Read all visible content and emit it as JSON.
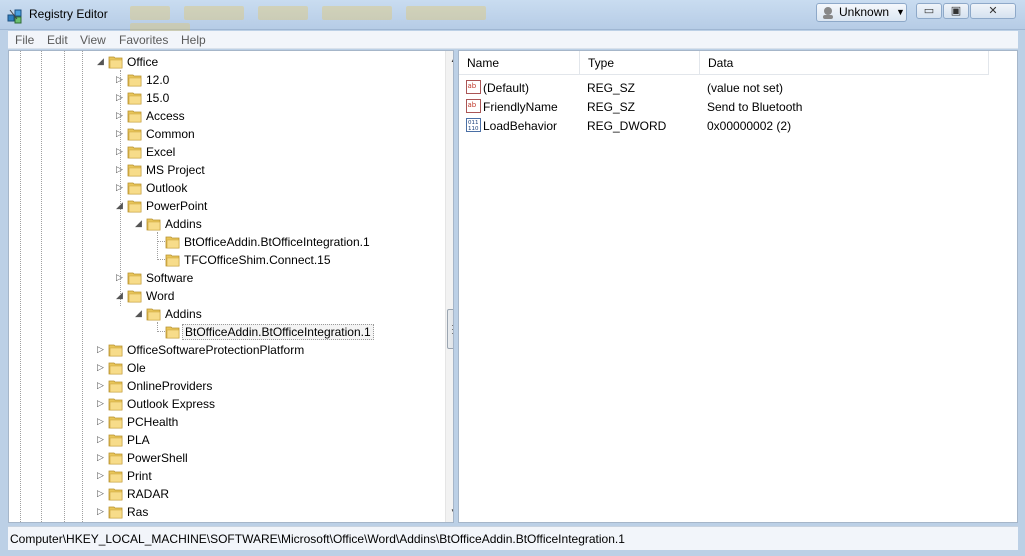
{
  "window": {
    "title": "Registry Editor",
    "account_label": "Unknown",
    "controls": {
      "minimize": "▭",
      "maximize": "▣",
      "close": "✕"
    }
  },
  "menu": {
    "items": [
      {
        "label": "File"
      },
      {
        "label": "Edit"
      },
      {
        "label": "View"
      },
      {
        "label": "Favorites"
      },
      {
        "label": "Help"
      }
    ]
  },
  "tree": {
    "nodes": [
      {
        "label": "Office",
        "expander": "◢",
        "expanded": true
      },
      {
        "label": "12.0",
        "expander": "▷"
      },
      {
        "label": "15.0",
        "expander": "▷"
      },
      {
        "label": "Access",
        "expander": "▷"
      },
      {
        "label": "Common",
        "expander": "▷"
      },
      {
        "label": "Excel",
        "expander": "▷"
      },
      {
        "label": "MS Project",
        "expander": "▷"
      },
      {
        "label": "Outlook",
        "expander": "▷"
      },
      {
        "label": "PowerPoint",
        "expander": "◢",
        "expanded": true
      },
      {
        "label": "Addins",
        "expander": "◢",
        "expanded": true
      },
      {
        "label": "BtOfficeAddin.BtOfficeIntegration.1",
        "expander": ""
      },
      {
        "label": "TFCOfficeShim.Connect.15",
        "expander": ""
      },
      {
        "label": "Software",
        "expander": "▷"
      },
      {
        "label": "Word",
        "expander": "◢",
        "expanded": true
      },
      {
        "label": "Addins",
        "expander": "◢",
        "expanded": true
      },
      {
        "label": "BtOfficeAddin.BtOfficeIntegration.1",
        "expander": "",
        "selected": true
      },
      {
        "label": "OfficeSoftwareProtectionPlatform",
        "expander": "▷"
      },
      {
        "label": "Ole",
        "expander": "▷"
      },
      {
        "label": "OnlineProviders",
        "expander": "▷"
      },
      {
        "label": "Outlook Express",
        "expander": "▷"
      },
      {
        "label": "PCHealth",
        "expander": "▷"
      },
      {
        "label": "PLA",
        "expander": "▷"
      },
      {
        "label": "PowerShell",
        "expander": "▷"
      },
      {
        "label": "Print",
        "expander": "▷"
      },
      {
        "label": "RADAR",
        "expander": "▷"
      },
      {
        "label": "Ras",
        "expander": "▷"
      }
    ]
  },
  "values_list": {
    "columns": [
      {
        "label": "Name"
      },
      {
        "label": "Type"
      },
      {
        "label": "Data"
      }
    ],
    "rows": [
      {
        "icon": "string-value-icon",
        "name": "(Default)",
        "type": "REG_SZ",
        "data": "(value not set)"
      },
      {
        "icon": "string-value-icon",
        "name": "FriendlyName",
        "type": "REG_SZ",
        "data": "Send to Bluetooth"
      },
      {
        "icon": "binary-value-icon",
        "name": "LoadBehavior",
        "type": "REG_DWORD",
        "data": "0x00000002 (2)"
      }
    ]
  },
  "status": {
    "path": "Computer\\HKEY_LOCAL_MACHINE\\SOFTWARE\\Microsoft\\Office\\Word\\Addins\\BtOfficeAddin.BtOfficeIntegration.1"
  },
  "colors": {
    "titlebar": "#c9dcf0",
    "folder": "#e8c55a",
    "pane_border": "#a6b6c9"
  }
}
